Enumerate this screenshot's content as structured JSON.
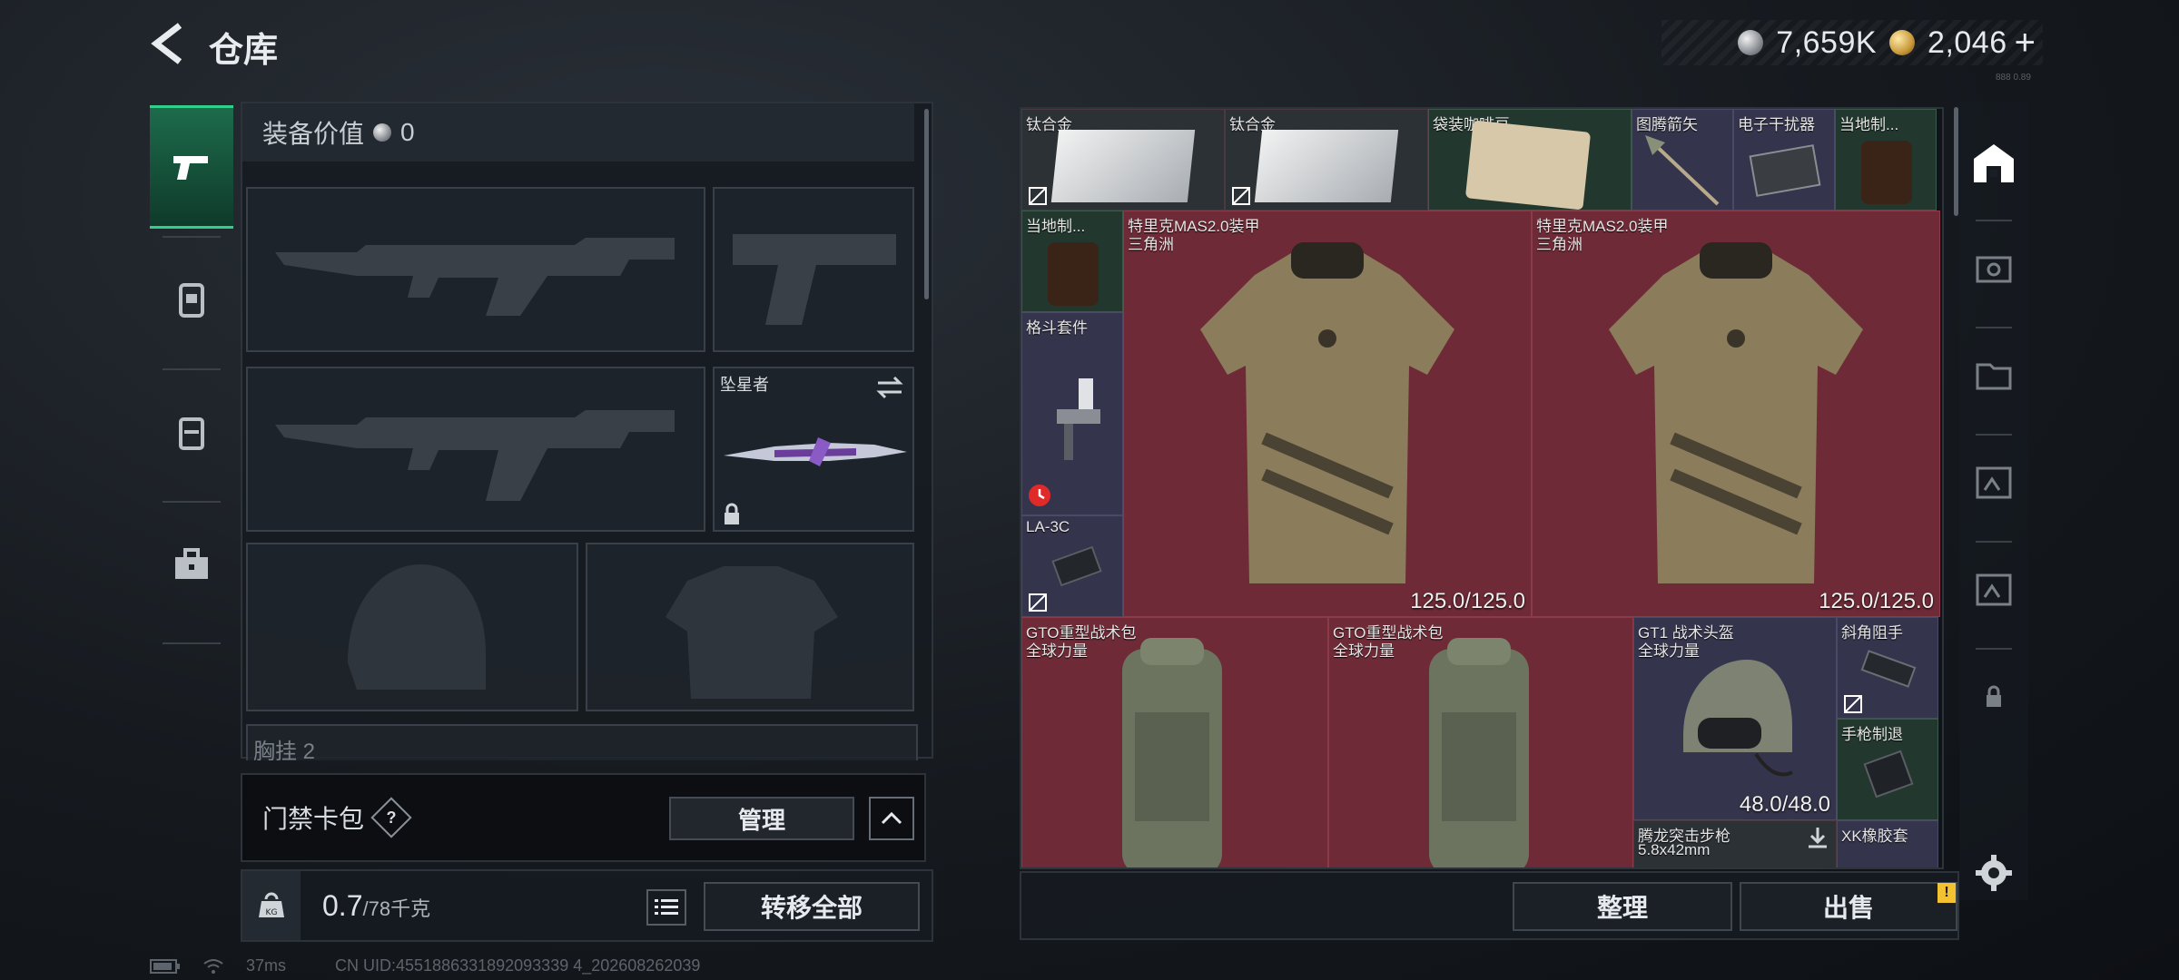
{
  "header": {
    "title": "仓库",
    "back_icon": "back-arrow-icon"
  },
  "currency": {
    "silver_value": "7,659K",
    "gold_value": "2,046",
    "plus_label": "+",
    "tiny_mark": "888 0.89"
  },
  "equipment": {
    "value_label": "装备价值",
    "value_amount": "0",
    "knife_label": "坠星者",
    "chest_label": "胸挂 2"
  },
  "card_bag": {
    "title": "门禁卡包",
    "help": "?",
    "manage_label": "管理"
  },
  "capacity": {
    "current": "0.7",
    "max": "/78千克",
    "transfer_label": "转移全部"
  },
  "storage": {
    "items": [
      {
        "name": "钛合金"
      },
      {
        "name": "钛合金"
      },
      {
        "name": "袋装咖啡豆"
      },
      {
        "name": "图腾箭矢"
      },
      {
        "name": "电子干扰器"
      },
      {
        "name": "当地制..."
      },
      {
        "name": "当地制..."
      },
      {
        "name": "特里克MAS2.0装甲",
        "sub": "三角洲",
        "durability": "125.0/125.0"
      },
      {
        "name": "特里克MAS2.0装甲",
        "sub": "三角洲",
        "durability": "125.0/125.0"
      },
      {
        "name": "格斗套件"
      },
      {
        "name": "LA-3C"
      },
      {
        "name": "GTO重型战术包",
        "sub": "全球力量"
      },
      {
        "name": "GTO重型战术包",
        "sub": "全球力量"
      },
      {
        "name": "GT1 战术头盔",
        "sub": "全球力量",
        "durability": "48.0/48.0"
      },
      {
        "name": "斜角阻手"
      },
      {
        "name": "手枪制退"
      },
      {
        "name": "腾龙突击步枪",
        "sub": "5.8x42mm"
      },
      {
        "name": "XK橡胶套"
      }
    ]
  },
  "actions": {
    "sort_label": "整理",
    "sell_label": "出售",
    "sell_alert": "!"
  },
  "status": {
    "ping": "37ms",
    "uid": "CN UID:4551886331892093339 4_202608262039"
  },
  "colors": {
    "accent": "#2fd08a",
    "rare_red": "#6e2a36",
    "uncommon_green": "#22382f",
    "epic_purple": "#34344c"
  }
}
